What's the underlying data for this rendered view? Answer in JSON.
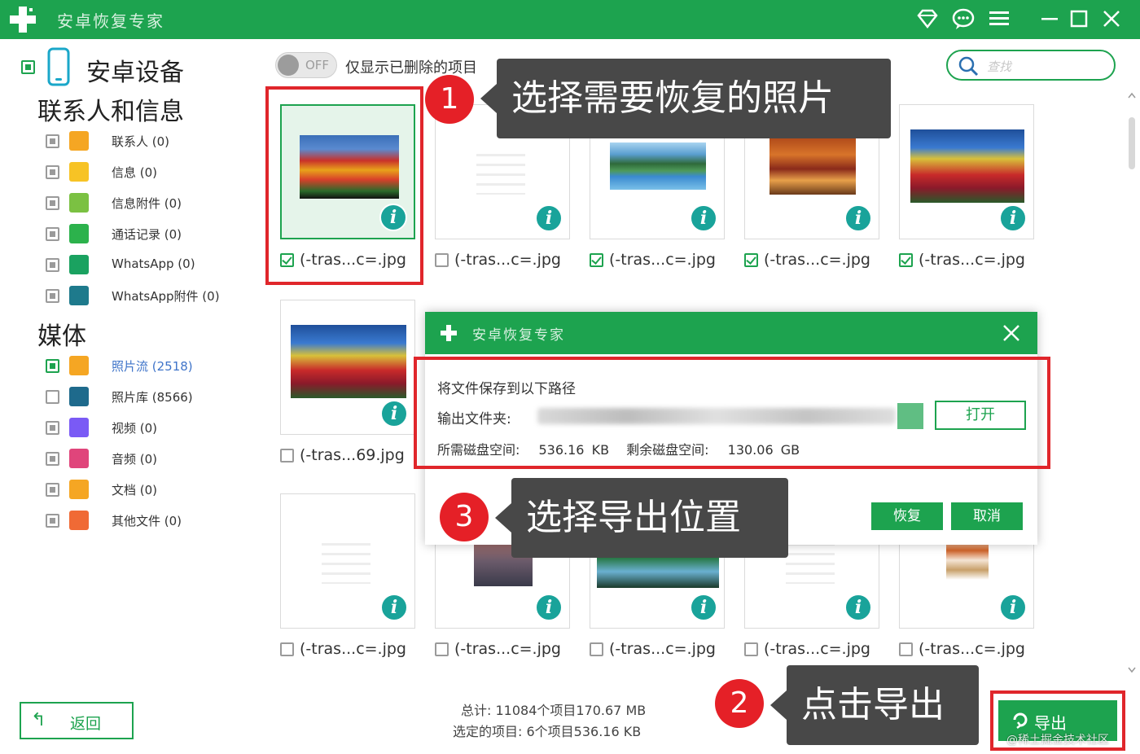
{
  "window": {
    "title": "安卓恢复专家"
  },
  "sidebar": {
    "root_label": "安卓设备",
    "section_contacts": "联系人和信息",
    "contacts_items": [
      {
        "label": "联系人 (0)",
        "icon": "contact-icon",
        "color": "#f5a623"
      },
      {
        "label": "信息 (0)",
        "icon": "message-icon",
        "color": "#f7c325"
      },
      {
        "label": "信息附件 (0)",
        "icon": "attachment-icon",
        "color": "#7bc142"
      },
      {
        "label": "通话记录 (0)",
        "icon": "phone-icon",
        "color": "#2cb24c"
      },
      {
        "label": "WhatsApp (0)",
        "icon": "whatsapp-icon",
        "color": "#1aa260"
      },
      {
        "label": "WhatsApp附件 (0)",
        "icon": "whatsapp-attachment-icon",
        "color": "#1e7a8c"
      }
    ],
    "section_media": "媒体",
    "media_items": [
      {
        "label": "照片流 (2518)",
        "icon": "photostream-icon",
        "color": "#f5a623"
      },
      {
        "label": "照片库 (8566)",
        "icon": "photo-library-icon",
        "color": "#1e6a8c"
      },
      {
        "label": "视频 (0)",
        "icon": "video-icon",
        "color": "#7a5af5"
      },
      {
        "label": "音频 (0)",
        "icon": "audio-icon",
        "color": "#e0457b"
      },
      {
        "label": "文档 (0)",
        "icon": "document-icon",
        "color": "#f5a623"
      },
      {
        "label": "其他文件 (0)",
        "icon": "other-files-icon",
        "color": "#f06a35"
      }
    ],
    "back_label": "返回"
  },
  "toolbar": {
    "toggle_state": "OFF",
    "toggle_label": "仅显示已删除的项目",
    "search_placeholder": "查找"
  },
  "grid": {
    "items": [
      {
        "name": "(-tras...c=.jpg",
        "checked": true
      },
      {
        "name": "(-tras...c=.jpg",
        "checked": false
      },
      {
        "name": "(-tras...c=.jpg",
        "checked": true
      },
      {
        "name": "(-tras...c=.jpg",
        "checked": true
      },
      {
        "name": "(-tras...c=.jpg",
        "checked": true
      },
      {
        "name": "(-tras...69.jpg",
        "checked": false
      },
      {
        "name": "(-tras...c=.jpg",
        "checked": false
      },
      {
        "name": "(-tras...c=.jpg",
        "checked": false
      },
      {
        "name": "(-tras...c=.jpg",
        "checked": false
      },
      {
        "name": "(-tras...c=.jpg",
        "checked": false
      },
      {
        "name": "(-tras...c=.jpg",
        "checked": false
      }
    ]
  },
  "dialog": {
    "title": "安卓恢复专家",
    "save_path_prompt": "将文件保存到以下路径",
    "output_folder_label": "输出文件夹:",
    "open_button": "打开",
    "required_space_label": "所需磁盘空间:",
    "required_space_value": "536.16 KB",
    "free_space_label": "剩余磁盘空间:",
    "free_space_value": "130.06 GB",
    "recover_button": "恢复",
    "cancel_button": "取消"
  },
  "annotations": {
    "step1_number": "1",
    "step1_text": "选择需要恢复的照片",
    "step2_number": "2",
    "step2_text": "点击导出",
    "step3_number": "3",
    "step3_text": "选择导出位置"
  },
  "footer": {
    "total_text": "总计: 11084个项目170.67 MB",
    "selected_text": "选定的项目: 6个项目536.16 KB",
    "export_label": "导出",
    "watermark": "@稀土掘金技术社区"
  },
  "colors": {
    "brand_green": "#1da34f",
    "highlight_red": "#e0262b",
    "badge_red": "#e52027",
    "callout_gray": "#484848",
    "info_teal": "#19a39a"
  }
}
